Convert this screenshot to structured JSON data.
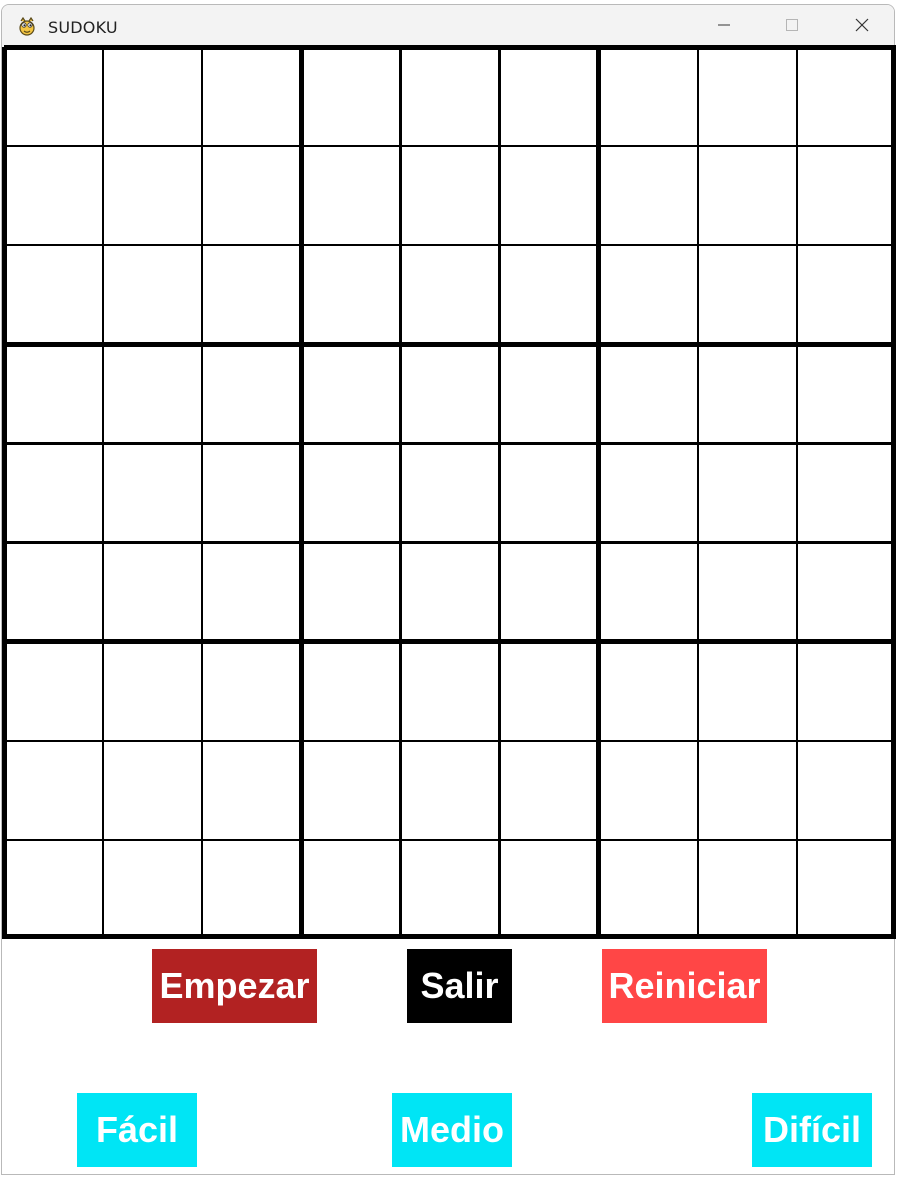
{
  "window": {
    "title": "SUDOKU",
    "icon": "python-snake-icon"
  },
  "board": {
    "size": 9,
    "cells": [
      [
        "",
        "",
        "",
        "",
        "",
        "",
        "",
        "",
        ""
      ],
      [
        "",
        "",
        "",
        "",
        "",
        "",
        "",
        "",
        ""
      ],
      [
        "",
        "",
        "",
        "",
        "",
        "",
        "",
        "",
        ""
      ],
      [
        "",
        "",
        "",
        "",
        "",
        "",
        "",
        "",
        ""
      ],
      [
        "",
        "",
        "",
        "",
        "",
        "",
        "",
        "",
        ""
      ],
      [
        "",
        "",
        "",
        "",
        "",
        "",
        "",
        "",
        ""
      ],
      [
        "",
        "",
        "",
        "",
        "",
        "",
        "",
        "",
        ""
      ],
      [
        "",
        "",
        "",
        "",
        "",
        "",
        "",
        "",
        ""
      ],
      [
        "",
        "",
        "",
        "",
        "",
        "",
        "",
        "",
        ""
      ]
    ]
  },
  "controls": {
    "empezar": {
      "label": "Empezar",
      "color": "#b22222"
    },
    "salir": {
      "label": "Salir",
      "color": "#000000"
    },
    "reiniciar": {
      "label": "Reiniciar",
      "color": "#ff4646"
    }
  },
  "difficulty": {
    "facil": {
      "label": "Fácil",
      "color": "#00e5f5"
    },
    "medio": {
      "label": "Medio",
      "color": "#00e5f5"
    },
    "dificil": {
      "label": "Difícil",
      "color": "#00e5f5"
    }
  }
}
